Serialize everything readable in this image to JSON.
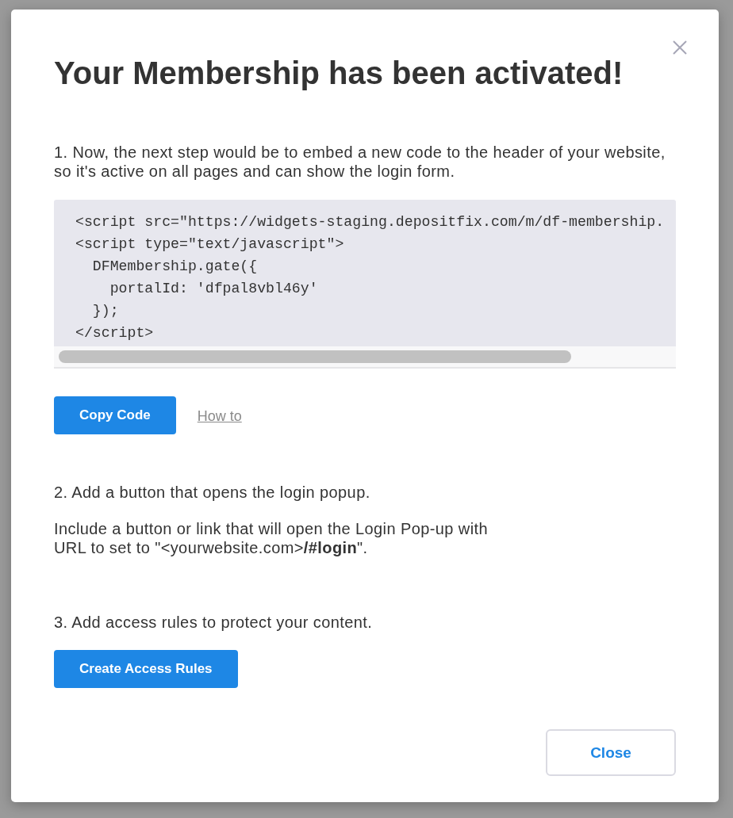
{
  "dialog": {
    "title": "Your Membership has been activated!"
  },
  "steps": [
    {
      "kind": "code",
      "text": "1. Now, the next step would be to embed a new code to the header of your website, so it's active on all pages and can show the login form.",
      "code_lines": [
        "<script src=\"https://widgets-staging.depositfix.com/m/df-membership.",
        "<script type=\"text/javascript\">",
        "  DFMembership.gate({",
        "    portalId: 'dfpal8vbl46y'",
        "  });",
        "</script>"
      ],
      "actions": [
        {
          "kind": "button",
          "label": "Copy Code"
        },
        {
          "kind": "link",
          "label": "How to"
        }
      ]
    },
    {
      "kind": "note",
      "text": "2. Add a button that opens the login popup.",
      "note": "Include a button or link that will open the Login Pop-up with URL to set to \"<yourwebsite.com>**/#login**\"."
    },
    {
      "kind": "button",
      "text": "3. Add access rules to protect your content.",
      "button": "Create Access Rules"
    }
  ],
  "footer": {
    "buttons": [
      "Close"
    ]
  }
}
